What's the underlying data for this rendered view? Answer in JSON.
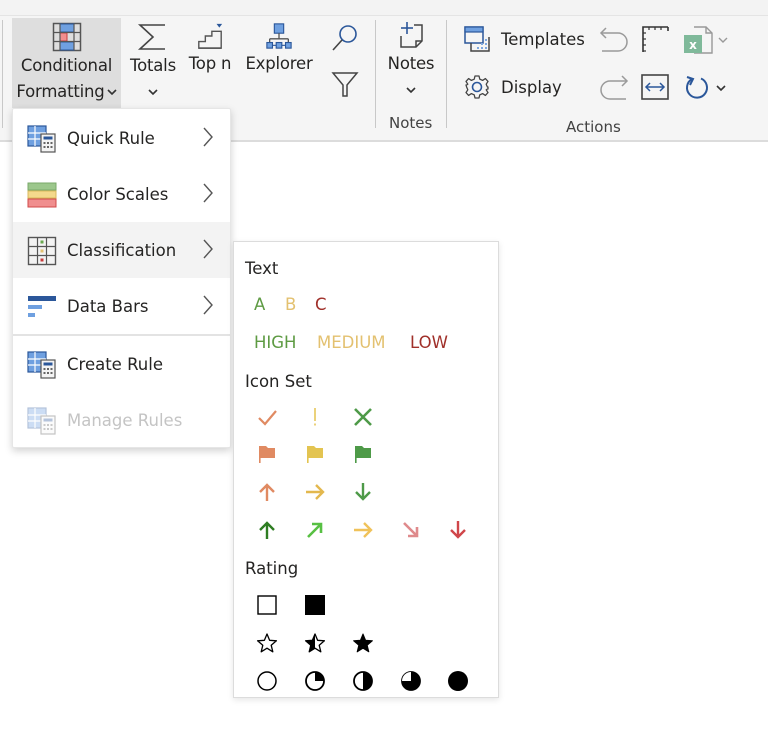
{
  "ribbon": {
    "conditional_formatting": {
      "line1": "Conditional",
      "line2": "Formatting",
      "chevron": "⌄"
    },
    "totals": {
      "label": "Totals",
      "chevron": "⌄"
    },
    "top_n": {
      "label": "Top n"
    },
    "explorer": {
      "label": "Explorer"
    },
    "notes": {
      "label": "Notes",
      "chevron": "⌄",
      "group_label": "Notes"
    },
    "templates": {
      "label": "Templates"
    },
    "display": {
      "label": "Display"
    },
    "actions_group_label": "Actions",
    "colors": {
      "accent_blue": "#2b579a",
      "light_blue": "#6fa0e0",
      "excel_green": "#7fb99a"
    }
  },
  "menu": {
    "items": [
      {
        "label": "Quick Rule",
        "icon": "quick-rule-icon",
        "has_submenu": true
      },
      {
        "label": "Color Scales",
        "icon": "color-scales-icon",
        "has_submenu": true
      },
      {
        "label": "Classification",
        "icon": "classification-icon",
        "has_submenu": true,
        "highlighted": true
      },
      {
        "label": "Data Bars",
        "icon": "data-bars-icon",
        "has_submenu": true
      },
      {
        "label": "Create Rule",
        "icon": "create-rule-icon",
        "has_submenu": false
      },
      {
        "label": "Manage Rules",
        "icon": "manage-rules-icon",
        "has_submenu": false,
        "disabled": true
      }
    ],
    "arrow": "›"
  },
  "submenu": {
    "text_heading": "Text",
    "letters": [
      {
        "text": "A",
        "color": "#5e9b43"
      },
      {
        "text": "B",
        "color": "#e3c170"
      },
      {
        "text": "C",
        "color": "#a0302a"
      }
    ],
    "levels": [
      {
        "text": "HIGH",
        "color": "#5e9b43"
      },
      {
        "text": "MEDIUM",
        "color": "#e3c170"
      },
      {
        "text": "LOW",
        "color": "#a0302a"
      }
    ],
    "icon_set_heading": "Icon Set",
    "icon_rows": [
      [
        {
          "name": "check-icon",
          "color": "#e08a62"
        },
        {
          "name": "exclamation-icon",
          "color": "#e6c65a"
        },
        {
          "name": "cross-icon",
          "color": "#4e9a48"
        }
      ],
      [
        {
          "name": "flag-icon",
          "color": "#e08a62"
        },
        {
          "name": "flag-icon",
          "color": "#e3c451"
        },
        {
          "name": "flag-icon",
          "color": "#4e9a48"
        }
      ],
      [
        {
          "name": "arrow-up-icon",
          "color": "#e08a62"
        },
        {
          "name": "arrow-right-icon",
          "color": "#e3b84e"
        },
        {
          "name": "arrow-down-icon",
          "color": "#4e9a48"
        }
      ],
      [
        {
          "name": "arrow-up-icon",
          "color": "#2e7d22"
        },
        {
          "name": "arrow-up-right-icon",
          "color": "#58c043"
        },
        {
          "name": "arrow-right-icon",
          "color": "#f0c25a"
        },
        {
          "name": "arrow-down-right-icon",
          "color": "#df8a8c"
        },
        {
          "name": "arrow-down-icon",
          "color": "#d0464a"
        }
      ]
    ],
    "rating_heading": "Rating",
    "rating_rows": [
      [
        "square-empty-icon",
        "square-full-icon"
      ],
      [
        "star-empty-icon",
        "star-half-icon",
        "star-full-icon"
      ],
      [
        "circle-empty-icon",
        "circle-quarter-icon",
        "circle-half-icon",
        "circle-three-quarter-icon",
        "circle-full-icon"
      ]
    ]
  }
}
